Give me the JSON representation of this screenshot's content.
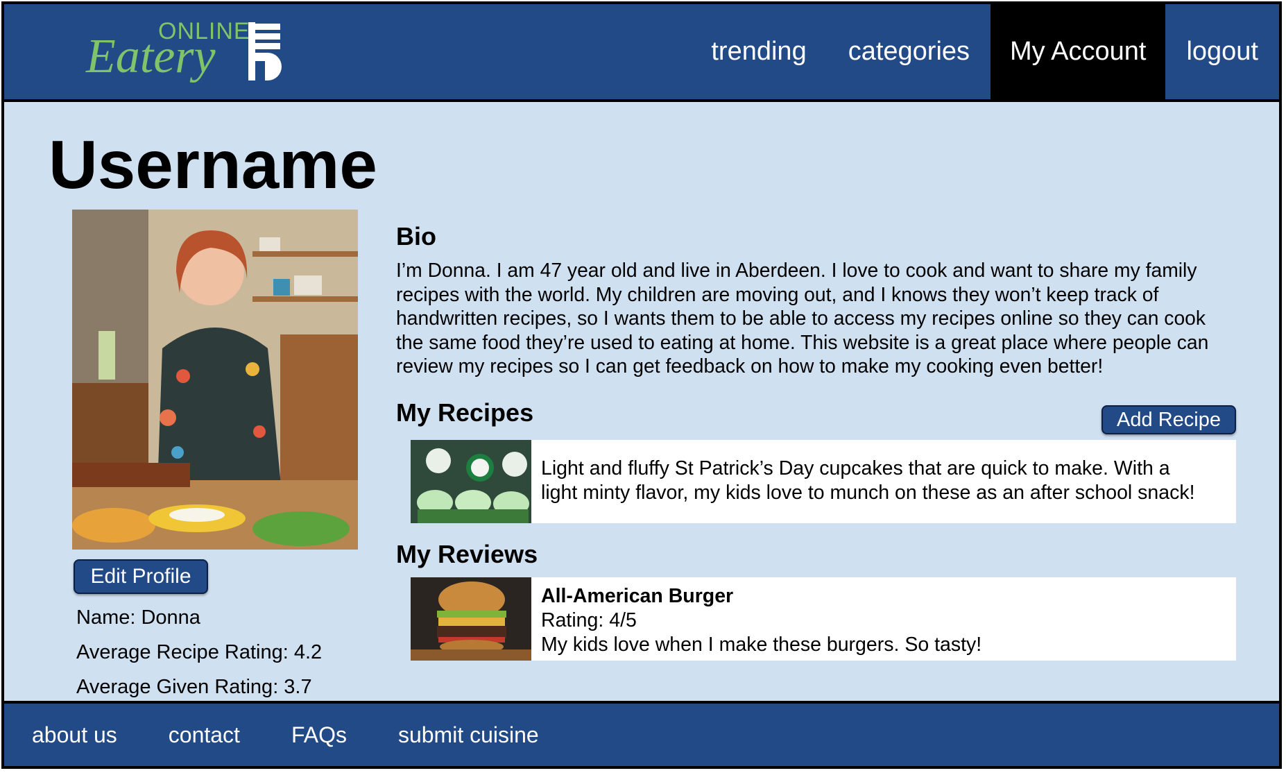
{
  "header": {
    "logo": {
      "top_text": "ONLINE",
      "script_text": "Eatery"
    },
    "nav": [
      {
        "label": "trending",
        "active": false
      },
      {
        "label": "categories",
        "active": false
      },
      {
        "label": "My Account",
        "active": true
      },
      {
        "label": "logout",
        "active": false
      }
    ]
  },
  "profile": {
    "title": "Username",
    "edit_button": "Edit Profile",
    "stats": [
      "Name: Donna",
      "Average Recipe Rating: 4.2",
      "Average Given Rating: 3.7"
    ]
  },
  "bio": {
    "heading": "Bio",
    "lines": [
      "I’m Donna. I am 47 year old and live in Aberdeen. I love to cook and want to share my family",
      "recipes with the world. My children are moving out, and I knows they won’t keep track of",
      "handwritten recipes, so I wants them to be able to access my recipes online so they can cook",
      "the same food they’re used to eating at home. This website is a great place where people can",
      "review my recipes so I can get feedback on how to make my cooking even better!"
    ]
  },
  "recipes": {
    "heading": "My Recipes",
    "add_button": "Add Recipe",
    "items": [
      {
        "lines": [
          "Light and fluffy St Patrick’s Day cupcakes that are quick to make. With a",
          "light minty flavor, my kids love to munch on these as an after school snack!"
        ]
      }
    ]
  },
  "reviews": {
    "heading": "My Reviews",
    "items": [
      {
        "title": "All-American Burger",
        "rating": "Rating: 4/5",
        "comment": "My kids love when I make these burgers. So tasty!"
      }
    ]
  },
  "footer": {
    "links": [
      "about us",
      "contact",
      "FAQs",
      "submit cuisine"
    ]
  },
  "colors": {
    "primary": "#224a87",
    "background": "#cfe0f1",
    "logo_green": "#7fc36a",
    "active_nav": "#000000"
  }
}
